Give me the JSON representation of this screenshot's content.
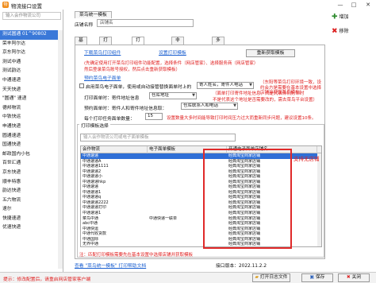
{
  "window": {
    "title": "物流接口设置",
    "app_icon": "物",
    "minimize": "—",
    "maximize": "□",
    "close": "✕"
  },
  "left": {
    "search_placeholder": "输入会作物流公司",
    "items": [
      "测试圆通 01^90802",
      "荣丰阿尔达",
      "京东阿尔达",
      "测试中通",
      "测试韵达",
      "中通速递",
      "天天快递",
      "\"圆通\" 速递",
      "德邦物流",
      "中铁快运",
      "申通快递",
      "圆通速递",
      "国通快递",
      "邮政国内小包",
      "百世汇通",
      "京东快递",
      "顺丰特惠",
      "韵达快递",
      "五六物流",
      "速尔",
      "快捷速递",
      "优速快递"
    ],
    "selected_index": 0
  },
  "header": {
    "top_tab": "菜鸟统一模板",
    "store_label": "店铺名称",
    "store_value": "店铺名",
    "add_label": "增加",
    "remove_label": "移除"
  },
  "tabs": [
    "基本设置",
    "打印机设置",
    "打印组件设置",
    "非南网户设置",
    "多店铺设置"
  ],
  "active_tab": 2,
  "pane": {
    "link_download": "下载菜鸟打印组件",
    "link_template": "设置打印模板",
    "btn_refresh": "重新获取模板",
    "red_note_1": "(先确定使用打开菜鸟打印组件功能配置，选择条件（网店管家）、选择服务商（网店管家）",
    "red_note_2": "然后登录菜鸟账号授权，然后点击重新获取模板）",
    "link_cainiao": "预约菜鸟电子面单",
    "chk_use_cainiao": "启用菜鸟电子面单，使用或自动接管替换面单时上的",
    "combo_replace": "寄人姓名，寄件人电话",
    "red_note_3": "（东阳等菜鸟打印环境一致，设约会方是需要在基本设置中选择店铺并获取菜鸟模板）",
    "print_addr_label": "打印面单时：寄件地址信息",
    "print_addr_value": "仓库地址",
    "red_note_4": "（面单打印寄件地址信息，只是代表你们打印时",
    "red_note_5": "不是代表这个地址是否需要改的，需去菜鸟平台设置）",
    "pre_print_label": "预约面单时：寄件人和寄件地址信息取：",
    "pre_print_value": "仓库联系人和电话",
    "batch_label": "每个打印任务面单数量：",
    "batch_value": "15",
    "red_note_6": "设置数量大多时间能导致打印时间压力过大而重新同步问题，建议设置10条。"
  },
  "template_group": {
    "title": "打印模板选择",
    "search_placeholder": "输入会作物流公司或电子面单模板",
    "headers": [
      "会作物流",
      "电子面单模板",
      "开通电子面单店铺名"
    ],
    "rows": [
      {
        "c1": "中通速递",
        "c2": "",
        "c3": "经典淘宝商家店铺",
        "sel": true
      },
      {
        "c1": "中通速递A",
        "c2": "",
        "c3": "经典淘宝商家店铺"
      },
      {
        "c1": "中通速递1111",
        "c2": "",
        "c3": "经典淘宝商家店铺"
      },
      {
        "c1": "中通速递2",
        "c2": "",
        "c3": "经典淘宝商家店铺"
      },
      {
        "c1": "中通速递小",
        "c2": "",
        "c3": "经典淘宝商家店铺"
      },
      {
        "c1": "中通速递hkp",
        "c2": "",
        "c3": "经典淘宝商家店铺"
      },
      {
        "c1": "中通速递",
        "c2": "",
        "c3": "经典淘宝商家店铺"
      },
      {
        "c1": "中通速递1",
        "c2": "",
        "c3": "经典淘宝商家店铺"
      },
      {
        "c1": "中通速递q",
        "c2": "",
        "c3": "经典淘宝商家店铺"
      },
      {
        "c1": "中通速递2222",
        "c2": "",
        "c3": "经典淘宝商家店铺"
      },
      {
        "c1": "中通速递打印",
        "c2": "",
        "c3": "经典淘宝商家店铺"
      },
      {
        "c1": "中通速递1",
        "c2": "",
        "c3": "经典淘宝商家店铺"
      },
      {
        "c1": "菜鸟中通",
        "c2": "中通快递一联单",
        "c3": "经典淘宝商家店铺"
      },
      {
        "c1": "abc中通",
        "c2": "",
        "c3": "经典淘宝商家店铺"
      },
      {
        "c1": "中通快运",
        "c2": "",
        "c3": "经典淘宝商家店铺"
      },
      {
        "c1": "中通代收货款",
        "c2": "",
        "c3": "经典淘宝商家店铺"
      },
      {
        "c1": "中通国际",
        "c2": "",
        "c3": "经典淘宝商家店铺"
      },
      {
        "c1": "无界中通",
        "c2": "",
        "c3": "经典淘宝商家店铺"
      }
    ],
    "support_text": "支持无店铺"
  },
  "footer_note": {
    "red_note": "注：匹配打印模板需要先在基本设置中选择店铺并获取模板",
    "link_help": "查看 \"菜鸟统一模板\" 打印帮助文档",
    "version": "接口版本：2022.11.2.2"
  },
  "statusbar": {
    "tip": "提示：修改配置后，请重启网店管家客户端",
    "open_log": "打开日志文件",
    "save": "保存",
    "close": "关闭"
  }
}
